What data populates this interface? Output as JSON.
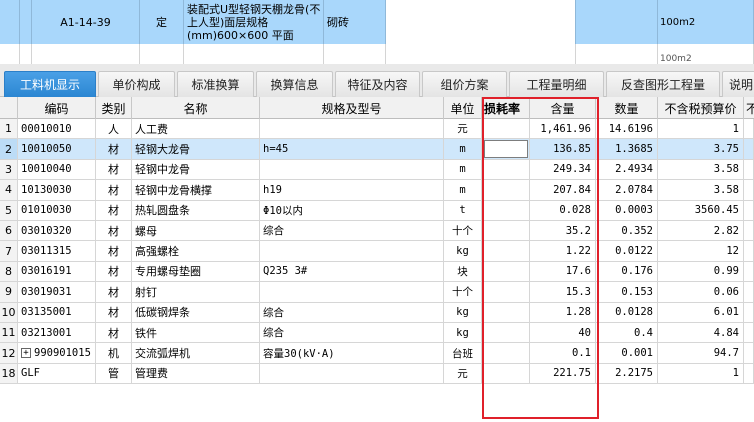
{
  "quota": {
    "code": "A1-14-39",
    "type": "定",
    "name": "装配式U型轻钢天棚龙骨(不上人型)面层规格(mm)600×600 平面",
    "feature": "砌砖",
    "unit": "100m2",
    "next_unit": "100m2"
  },
  "tabs": [
    {
      "label": "工料机显示",
      "active": true
    },
    {
      "label": "单价构成",
      "active": false
    },
    {
      "label": "标准换算",
      "active": false
    },
    {
      "label": "换算信息",
      "active": false
    },
    {
      "label": "特征及内容",
      "active": false
    },
    {
      "label": "组价方案",
      "active": false
    },
    {
      "label": "工程量明细",
      "active": false
    },
    {
      "label": "反查图形工程量",
      "active": false
    },
    {
      "label": "说明",
      "active": false
    }
  ],
  "columns": {
    "code": "编码",
    "kind": "类别",
    "name": "名称",
    "spec": "规格及型号",
    "unit": "单位",
    "loss": "损耗率",
    "content": "含量",
    "qty": "数量",
    "price": "不含税预算价",
    "extra": "不"
  },
  "rows": [
    {
      "idx": "1",
      "code": "00010010",
      "kind": "人",
      "name": "人工费",
      "spec": "",
      "unit": "元",
      "content": "1,461.96",
      "qty": "14.6196",
      "price": "1",
      "expand": false
    },
    {
      "idx": "2",
      "code": "10010050",
      "kind": "材",
      "name": "轻钢大龙骨",
      "spec": "h=45",
      "unit": "m",
      "content": "136.85",
      "qty": "1.3685",
      "price": "3.75",
      "expand": false
    },
    {
      "idx": "3",
      "code": "10010040",
      "kind": "材",
      "name": "轻钢中龙骨",
      "spec": "",
      "unit": "m",
      "content": "249.34",
      "qty": "2.4934",
      "price": "3.58",
      "expand": false
    },
    {
      "idx": "4",
      "code": "10130030",
      "kind": "材",
      "name": "轻钢中龙骨横撑",
      "spec": "h19",
      "unit": "m",
      "content": "207.84",
      "qty": "2.0784",
      "price": "3.58",
      "expand": false
    },
    {
      "idx": "5",
      "code": "01010030",
      "kind": "材",
      "name": "热轧圆盘条",
      "spec": "Φ10以内",
      "unit": "t",
      "content": "0.028",
      "qty": "0.0003",
      "price": "3560.45",
      "expand": false
    },
    {
      "idx": "6",
      "code": "03010320",
      "kind": "材",
      "name": "螺母",
      "spec": "综合",
      "unit": "十个",
      "content": "35.2",
      "qty": "0.352",
      "price": "2.82",
      "expand": false
    },
    {
      "idx": "7",
      "code": "03011315",
      "kind": "材",
      "name": "高强螺栓",
      "spec": "",
      "unit": "kg",
      "content": "1.22",
      "qty": "0.0122",
      "price": "12",
      "expand": false
    },
    {
      "idx": "8",
      "code": "03016191",
      "kind": "材",
      "name": "专用螺母垫圈",
      "spec": "Q235 3#",
      "unit": "块",
      "content": "17.6",
      "qty": "0.176",
      "price": "0.99",
      "expand": false
    },
    {
      "idx": "9",
      "code": "03019031",
      "kind": "材",
      "name": "射钉",
      "spec": "",
      "unit": "十个",
      "content": "15.3",
      "qty": "0.153",
      "price": "0.06",
      "expand": false
    },
    {
      "idx": "10",
      "code": "03135001",
      "kind": "材",
      "name": "低碳钢焊条",
      "spec": "综合",
      "unit": "kg",
      "content": "1.28",
      "qty": "0.0128",
      "price": "6.01",
      "expand": false
    },
    {
      "idx": "11",
      "code": "03213001",
      "kind": "材",
      "name": "铁件",
      "spec": "综合",
      "unit": "kg",
      "content": "40",
      "qty": "0.4",
      "price": "4.84",
      "expand": false
    },
    {
      "idx": "12",
      "code": "990901015",
      "kind": "机",
      "name": "交流弧焊机",
      "spec": "容量30(kV·A)",
      "unit": "台班",
      "content": "0.1",
      "qty": "0.001",
      "price": "94.7",
      "expand": true
    },
    {
      "idx": "18",
      "code": "GLF",
      "kind": "管",
      "name": "管理费",
      "spec": "",
      "unit": "元",
      "content": "221.75",
      "qty": "2.2175",
      "price": "1",
      "expand": false
    }
  ],
  "selected_row_index": 1,
  "expand_symbol": "+",
  "colors": {
    "selected_row": "#cfe7fb",
    "active_tab": "#2b86d2",
    "highlight_box": "#e0202a",
    "quota_row": "#a9d7fb"
  }
}
